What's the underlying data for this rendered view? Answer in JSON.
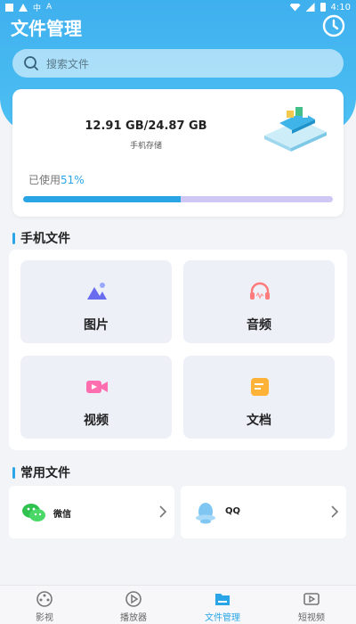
{
  "status_bar": {
    "time": "4:10",
    "left_icons": [
      "square-icon",
      "warning-icon",
      "network-icon",
      "a-icon"
    ],
    "right_icons": [
      "wifi-icon",
      "signal-icon",
      "battery-icon"
    ]
  },
  "header": {
    "title": "文件管理",
    "history_icon": "clock-icon"
  },
  "search": {
    "placeholder": "搜索文件",
    "icon": "search-icon"
  },
  "storage": {
    "amount": "12.91 GB/24.87 GB",
    "label": "手机存储",
    "usage_prefix": "已使用",
    "usage_percent": "51%",
    "fill_fraction": 0.51
  },
  "sections": {
    "phone_files": "手机文件",
    "common_files": "常用文件"
  },
  "phone_files": [
    {
      "label": "图片",
      "icon": "image-icon"
    },
    {
      "label": "音频",
      "icon": "headphones-icon"
    },
    {
      "label": "视频",
      "icon": "video-camera-icon"
    },
    {
      "label": "文档",
      "icon": "document-icon"
    }
  ],
  "common_files": [
    {
      "label": "微信",
      "icon": "wechat-icon"
    },
    {
      "label": "QQ",
      "icon": "qq-icon"
    }
  ],
  "bottom_nav": [
    {
      "label": "影视",
      "icon": "film-reel-icon",
      "active": false
    },
    {
      "label": "播放器",
      "icon": "play-icon",
      "active": false
    },
    {
      "label": "文件管理",
      "icon": "folder-icon",
      "active": true
    },
    {
      "label": "短视频",
      "icon": "short-video-icon",
      "active": false
    }
  ],
  "colors": {
    "accent": "#2aa6e8",
    "header": "#3fb0ee",
    "progress_track": "#cfc8f4"
  }
}
